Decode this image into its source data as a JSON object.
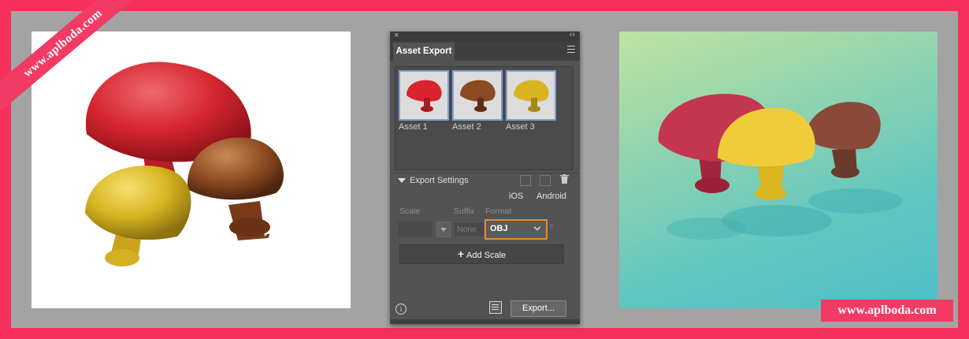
{
  "watermark_ribbon": "www.aplboda.com",
  "watermark_bottom": "www.aplboda.com",
  "panel": {
    "close_glyph": "×",
    "collapse_glyph": "‹‹",
    "tab_label": "Asset Export",
    "assets": [
      {
        "label": "Asset 1",
        "color": "#d9232e"
      },
      {
        "label": "Asset 2",
        "color": "#8a4a22"
      },
      {
        "label": "Asset 3",
        "color": "#d9b422"
      }
    ],
    "export_settings_label": "Export Settings",
    "platform_ios": "iOS",
    "platform_android": "Android",
    "col_scale": "Scale",
    "col_suffix": "Suffix",
    "col_format": "Format",
    "suffix_placeholder": "None",
    "format_value": "OBJ",
    "add_scale_plus": "+",
    "add_scale_label": "Add Scale",
    "info_glyph": "i",
    "export_button": "Export..."
  },
  "colors": {
    "frame_border": "#f5305a",
    "accent_highlight": "#e38d2c",
    "panel_bg": "#535353"
  }
}
